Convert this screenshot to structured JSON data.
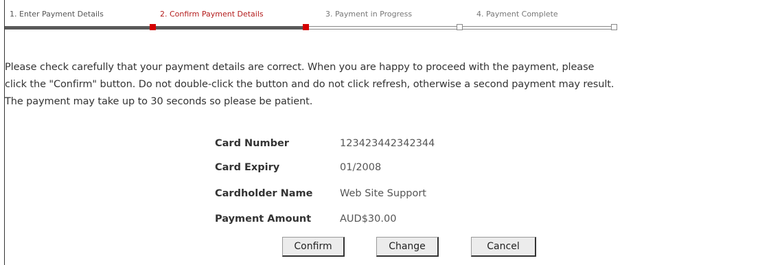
{
  "steps": [
    {
      "label": "1. Enter Payment Details",
      "state": "done"
    },
    {
      "label": "2. Confirm Payment Details",
      "state": "active"
    },
    {
      "label": "3. Payment in Progress",
      "state": "todo"
    },
    {
      "label": "4. Payment Complete",
      "state": "todo"
    }
  ],
  "intro": {
    "line1": "Please check carefully that your payment details are correct. When you are happy to proceed with the payment, please",
    "line2": "click the \"Confirm\" button. Do not double-click the button and do not click refresh, otherwise a second payment may result.",
    "line3": "The payment may take up to 30 seconds so please be patient."
  },
  "details": {
    "card_number": {
      "label": "Card Number",
      "value": "123423442342344"
    },
    "card_expiry": {
      "label": "Card Expiry",
      "value": "01/2008"
    },
    "cardholder_name": {
      "label": "Cardholder Name",
      "value": "Web Site Support"
    },
    "payment_amount": {
      "label": "Payment Amount",
      "value": "AUD$30.00"
    }
  },
  "buttons": {
    "confirm": "Confirm",
    "change": "Change",
    "cancel": "Cancel"
  },
  "colors": {
    "active_step": "#b31b1b",
    "marker": "#d40000",
    "track_done": "#5a5a5a"
  }
}
